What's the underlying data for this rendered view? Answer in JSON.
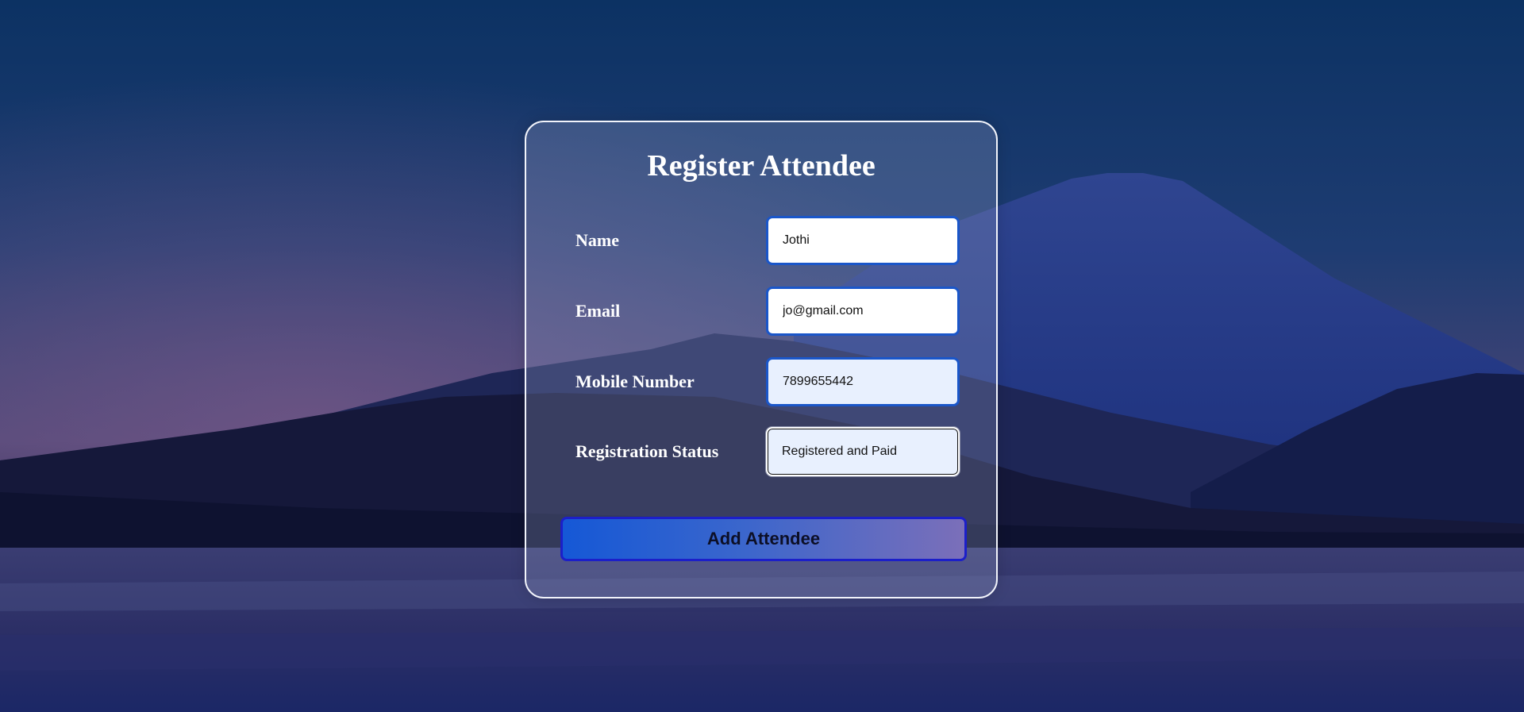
{
  "form": {
    "title": "Register Attendee",
    "fields": [
      {
        "label": "Name",
        "value": "Jothi"
      },
      {
        "label": "Email",
        "value": "jo@gmail.com"
      },
      {
        "label": "Mobile Number",
        "value": "7899655442"
      },
      {
        "label": "Registration Status",
        "value": "Registered and Paid"
      }
    ],
    "submit_label": "Add Attendee"
  },
  "colors": {
    "sky_top": "#0d3264",
    "sky_mid": "#3b3d70",
    "mountain": "#1c2f7a",
    "input_border": "#1a56c9",
    "button_start": "#1558d6",
    "button_end": "#7b6fb9"
  }
}
